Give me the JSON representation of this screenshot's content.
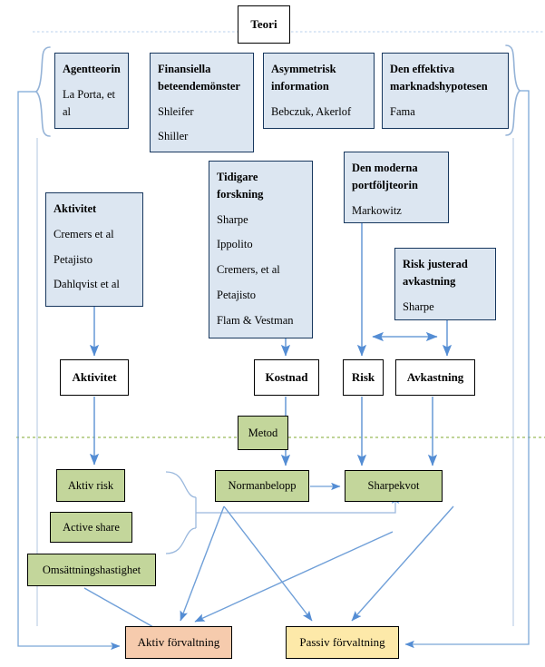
{
  "diagram": {
    "title": "Teori",
    "sections": {
      "theory_label": "Teori",
      "method_label": "Metod"
    },
    "theory_boxes": [
      {
        "id": "agentteorin",
        "header": "Agentteorin",
        "items": [
          "La Porta, et al"
        ]
      },
      {
        "id": "finansiella-beteendemonster",
        "header": "Finansiella beteendemönster",
        "items": [
          "Shleifer",
          "Shiller"
        ]
      },
      {
        "id": "asymmetrisk-information",
        "header": "Asymmetrisk information",
        "items": [
          "Bebczuk, Akerlof"
        ]
      },
      {
        "id": "den-effektiva-marknadshypotesen",
        "header": "Den effektiva marknadshypotesen",
        "items": [
          "Fama"
        ]
      },
      {
        "id": "aktivitet-teori",
        "header": "Aktivitet",
        "items": [
          "Cremers et al",
          "Petajisto",
          "Dahlqvist et al"
        ]
      },
      {
        "id": "tidigare-forskning",
        "header": "Tidigare forskning",
        "items": [
          "Sharpe",
          "Ippolito",
          "Cremers, et al",
          "Petajisto",
          "Flam & Vestman"
        ]
      },
      {
        "id": "den-moderna-portfoljteorin",
        "header": "Den moderna portföljteorin",
        "items": [
          "Markowitz"
        ]
      },
      {
        "id": "risk-justerad-avkastning",
        "header": "Risk justerad avkastning",
        "items": [
          "Sharpe"
        ]
      }
    ],
    "concept_boxes": [
      {
        "id": "aktivitet",
        "label": "Aktivitet"
      },
      {
        "id": "kostnad",
        "label": "Kostnad"
      },
      {
        "id": "risk",
        "label": "Risk"
      },
      {
        "id": "avkastning",
        "label": "Avkastning"
      }
    ],
    "method_boxes": [
      {
        "id": "metod",
        "label": "Metod"
      },
      {
        "id": "aktiv-risk",
        "label": "Aktiv risk"
      },
      {
        "id": "active-share",
        "label": "Active share"
      },
      {
        "id": "omsattningshastighet",
        "label": "Omsättningshastighet"
      },
      {
        "id": "normanbelopp",
        "label": "Normanbelopp"
      },
      {
        "id": "sharpekvot",
        "label": "Sharpekvot"
      }
    ],
    "result_boxes": [
      {
        "id": "aktiv-forvaltning",
        "label": "Aktiv förvaltning"
      },
      {
        "id": "passiv-forvaltning",
        "label": "Passiv förvaltning"
      }
    ],
    "colors": {
      "theory_fill": "#dce6f1",
      "theory_stroke": "#17375e",
      "method_fill": "#c3d69b",
      "active_fill": "#f6cbad",
      "passive_fill": "#fde9a9",
      "arrow": "#548dd4",
      "divider_top": "#c6d9f0",
      "divider_method": "#9bbb59"
    }
  }
}
